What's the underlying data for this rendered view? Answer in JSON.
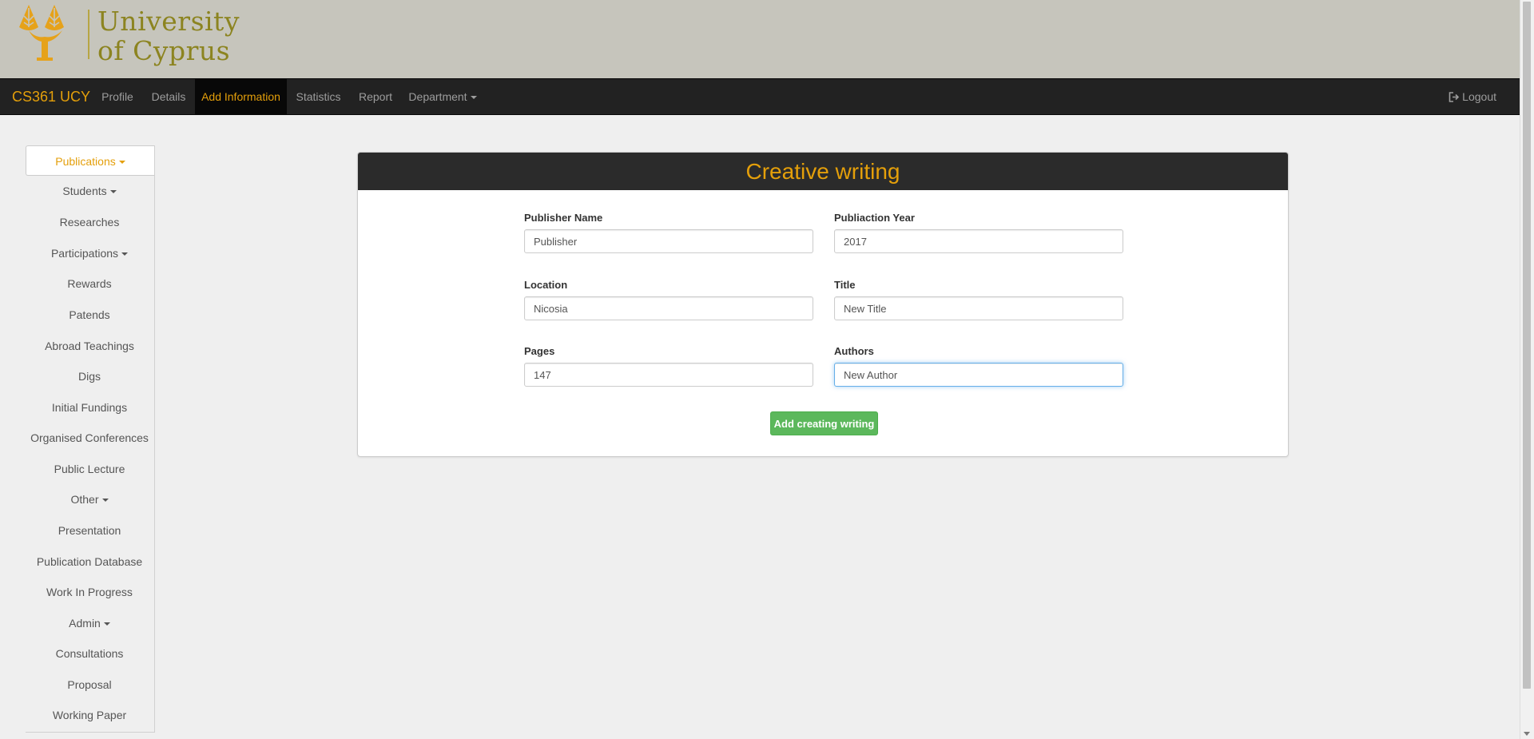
{
  "banner": {
    "logo_line1": "University",
    "logo_line2": "of Cyprus",
    "logo_icon": "tree-icon"
  },
  "navbar": {
    "brand": "CS361 UCY",
    "items": [
      {
        "label": "Profile",
        "active": false
      },
      {
        "label": "Details",
        "active": false
      },
      {
        "label": "Add Information",
        "active": true
      },
      {
        "label": "Statistics",
        "active": false
      },
      {
        "label": "Report",
        "active": false
      },
      {
        "label": "Department",
        "active": false,
        "dropdown": true
      }
    ],
    "logout_label": "Logout",
    "logout_icon": "sign-out-icon"
  },
  "sidebar": {
    "items": [
      {
        "label": "Publications",
        "active": true,
        "dropdown": true
      },
      {
        "label": "Students",
        "dropdown": true
      },
      {
        "label": "Researches"
      },
      {
        "label": "Participations",
        "dropdown": true
      },
      {
        "label": "Rewards"
      },
      {
        "label": "Patends"
      },
      {
        "label": "Abroad Teachings"
      },
      {
        "label": "Digs"
      },
      {
        "label": "Initial Fundings"
      },
      {
        "label": "Organised Conferences"
      },
      {
        "label": "Public Lecture"
      },
      {
        "label": "Other",
        "dropdown": true
      },
      {
        "label": "Presentation"
      },
      {
        "label": "Publication Database"
      },
      {
        "label": "Work In Progress"
      },
      {
        "label": "Admin",
        "dropdown": true
      },
      {
        "label": "Consultations"
      },
      {
        "label": "Proposal"
      },
      {
        "label": "Working Paper"
      }
    ]
  },
  "form": {
    "title": "Creative writing",
    "fields": {
      "publisher_name": {
        "label": "Publisher Name",
        "value": "Publisher"
      },
      "publication_year": {
        "label": "Publiaction Year",
        "value": "2017"
      },
      "location": {
        "label": "Location",
        "value": "Nicosia"
      },
      "title": {
        "label": "Title",
        "value": "New Title"
      },
      "pages": {
        "label": "Pages",
        "value": "147"
      },
      "authors": {
        "label": "Authors",
        "value": "New Author"
      }
    },
    "submit_label": "Add creating writing"
  },
  "colors": {
    "accent": "#e49f0a",
    "navbar_bg": "#222222",
    "banner_bg": "#c6c5bc",
    "success": "#5cb85c",
    "logo_text": "#8c8420"
  }
}
